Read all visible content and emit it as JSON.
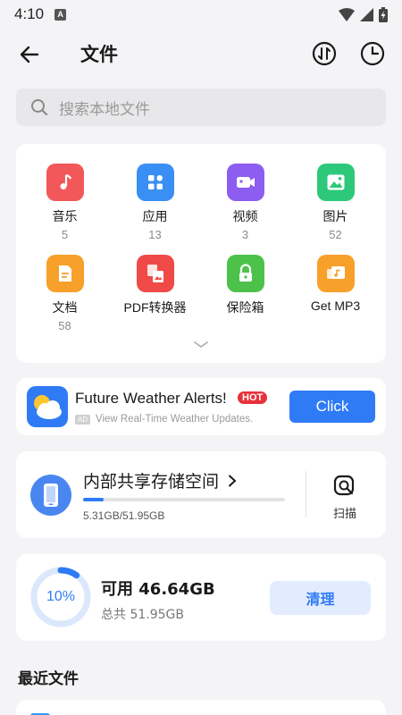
{
  "status_bar": {
    "time": "4:10",
    "notification_letter": "A"
  },
  "header": {
    "title": "文件"
  },
  "search": {
    "placeholder": "搜索本地文件"
  },
  "categories": [
    {
      "label": "音乐",
      "count": "5",
      "icon": "music-note-icon",
      "color": "#f2585a"
    },
    {
      "label": "应用",
      "count": "13",
      "icon": "apps-grid-icon",
      "color": "#3a8ff5"
    },
    {
      "label": "视频",
      "count": "3",
      "icon": "video-icon",
      "color": "#8d5cf0"
    },
    {
      "label": "图片",
      "count": "52",
      "icon": "image-icon",
      "color": "#2ec87a"
    },
    {
      "label": "文档",
      "count": "58",
      "icon": "document-icon",
      "color": "#f7a02a"
    },
    {
      "label": "PDF转换器",
      "count": "",
      "icon": "pdf-converter-icon",
      "color": "#ef4a47"
    },
    {
      "label": "保险箱",
      "count": "",
      "icon": "lock-icon",
      "color": "#4cc24a"
    },
    {
      "label": "Get MP3",
      "count": "",
      "icon": "music-folder-icon",
      "color": "#f7a02a"
    }
  ],
  "ad": {
    "title": "Future Weather Alerts!",
    "hot_badge": "HOT",
    "ad_badge": "AD",
    "subtitle": "View Real-Time Weather Updates.",
    "cta": "Click"
  },
  "storage": {
    "title": "内部共享存储空间",
    "used_text": "5.31GB/51.95GB",
    "used_fraction": 0.102,
    "scan_label": "扫描"
  },
  "usage": {
    "percent_label": "10%",
    "percent_value": 10,
    "available": "可用 46.64GB",
    "total": "总共 51.95GB",
    "clean_label": "清理"
  },
  "recent": {
    "title": "最近文件"
  },
  "colors": {
    "accent": "#2f7bf6",
    "background": "#f4f4f6"
  }
}
